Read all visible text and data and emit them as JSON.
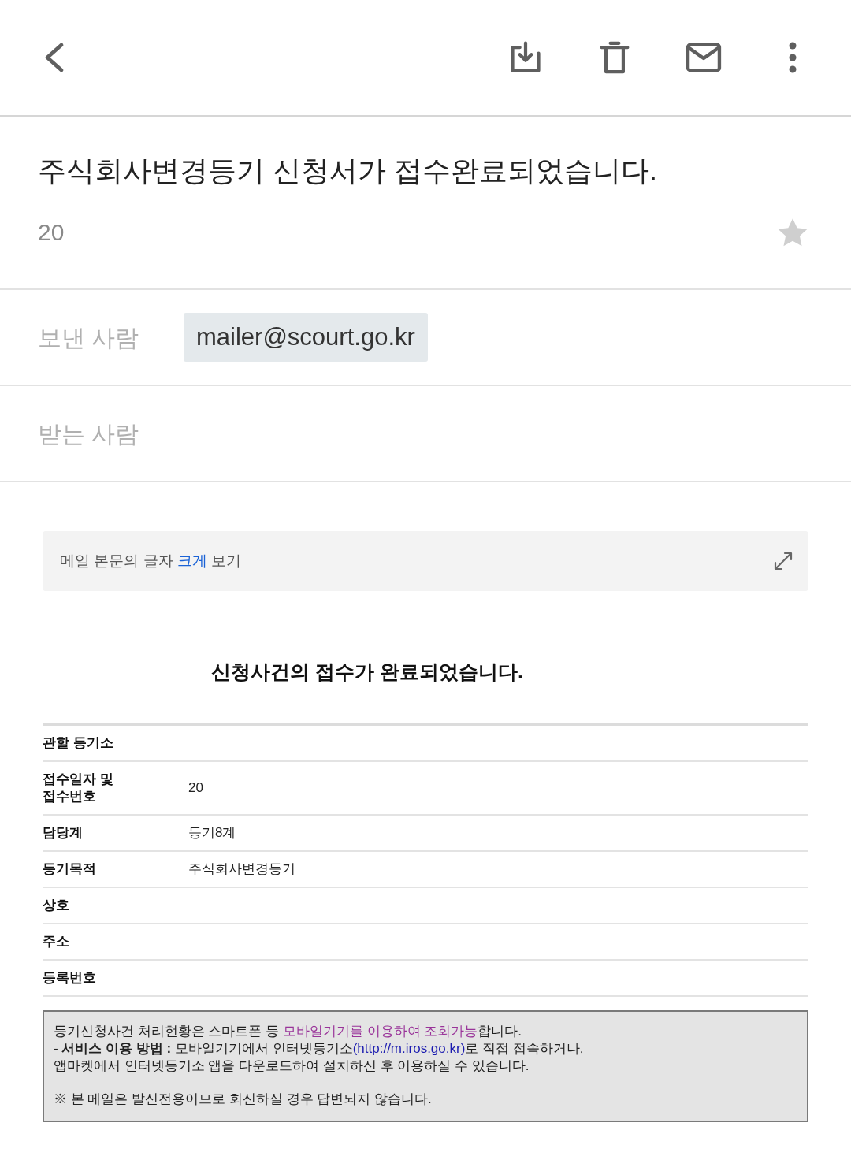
{
  "message": {
    "subject": "주식회사변경등기 신청서가 접수완료되었습니다.",
    "date": "20",
    "starred": false
  },
  "sender": {
    "label": "보낸 사람",
    "address": "mailer@scourt.go.kr"
  },
  "recipient": {
    "label": "받는 사람"
  },
  "text_size_banner": {
    "segments": [
      {
        "text": "메일 본문의 글자 ",
        "kind": "plain"
      },
      {
        "text": "크게",
        "kind": "accent"
      },
      {
        "text": " 보기",
        "kind": "plain"
      }
    ]
  },
  "body": {
    "heading": "신청사건의 접수가 완료되었습니다.",
    "table": {
      "rows": [
        {
          "label": "관할 등기소"
        },
        {
          "label": "접수일자 및 접수번호",
          "value": "20"
        },
        {
          "label": "담당계",
          "value": "등기8계"
        },
        {
          "label": "등기목적",
          "value": "주식회사변경등기"
        },
        {
          "label": "상호"
        },
        {
          "label": "주소"
        },
        {
          "label": "등록번호"
        }
      ]
    },
    "notice": {
      "paragraphs": [
        {
          "lines": [
            [
              {
                "text": "등기신청사건 처리현황은 스마트폰 등 ",
                "kind": "plain"
              },
              {
                "text": "모바일기기를 이용하여 조회가능",
                "kind": "highlight"
              },
              {
                "text": "합니다.",
                "kind": "plain"
              }
            ],
            [
              {
                "text": "- ",
                "kind": "plain"
              },
              {
                "text": "서비스 이용 방법 :",
                "kind": "bold"
              },
              {
                "text": " 모바일기기에서 인터넷등기소",
                "kind": "plain"
              },
              {
                "text": "(http://m.iros.go.kr)",
                "kind": "link"
              },
              {
                "text": "로 직접 접속하거나,",
                "kind": "plain"
              }
            ],
            [
              {
                "text": "앱마켓에서 인터넷등기소 앱을 다운로드하여 설치하신 후 이용하실 수 있습니다.",
                "kind": "plain"
              }
            ]
          ]
        },
        {
          "lines": [
            [
              {
                "text": "※ 본 메일은 발신전용이므로 회신하실 경우 답변되지 않습니다.",
                "kind": "plain"
              }
            ]
          ]
        }
      ]
    }
  }
}
